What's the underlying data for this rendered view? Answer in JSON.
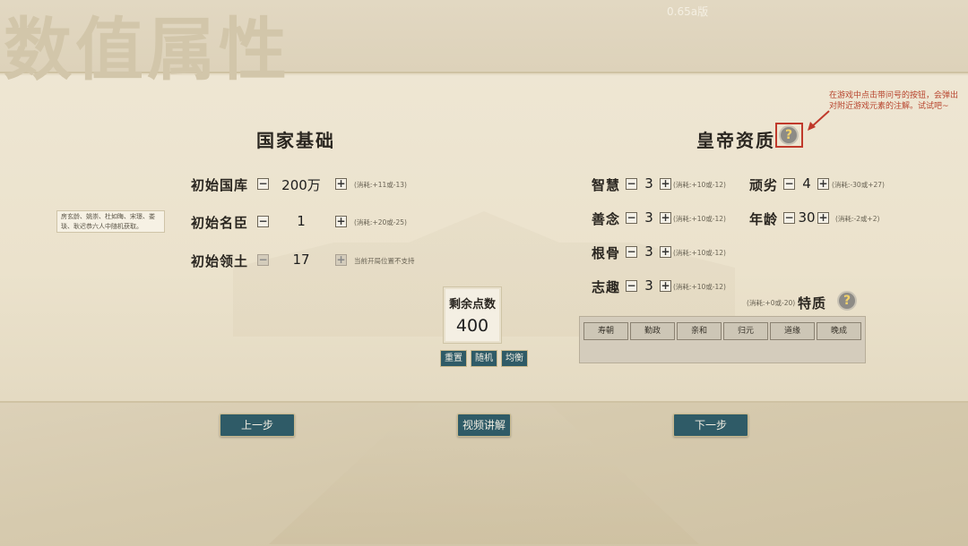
{
  "version": "0.65a版",
  "page_title": "数值属性",
  "hint": "在游戏中点击带问号的按钮，会弹出对附近游戏元素的注解。试试吧~",
  "help_symbol": "?",
  "national": {
    "heading": "国家基础",
    "treasury": {
      "label": "初始国库",
      "value": "200万",
      "cost": "(消耗:+11或-13)"
    },
    "ministers": {
      "label": "初始名臣",
      "value": "1",
      "cost": "(消耗:+20或-25)"
    },
    "territory": {
      "label": "初始领土",
      "value": "17",
      "cost": "当前开局位置不支持"
    },
    "minister_note": "房玄龄、姚崇、杜如晦、宋璟、娄琰、耿迟恭六人中随机获取。"
  },
  "points": {
    "label": "剩余点数",
    "value": "400",
    "reset": "重置",
    "random": "随机",
    "balance": "均衡"
  },
  "emperor": {
    "heading": "皇帝资质",
    "wisdom": {
      "label": "智慧",
      "value": "3",
      "cost": "(消耗:+10或-12)"
    },
    "kindness": {
      "label": "善念",
      "value": "3",
      "cost": "(消耗:+10或-12)"
    },
    "constitution": {
      "label": "根骨",
      "value": "3",
      "cost": "(消耗:+10或-12)"
    },
    "ambition": {
      "label": "志趣",
      "value": "3",
      "cost": "(消耗:+10或-12)"
    },
    "stubbornness": {
      "label": "顽劣",
      "value": "4",
      "cost": "(消耗:-30或+27)"
    },
    "age": {
      "label": "年龄",
      "value": "30",
      "cost": "(消耗:-2或+2)"
    },
    "traits": {
      "label": "特质",
      "cost": "(消耗:+0或-20)",
      "items": [
        "寿朝",
        "勤政",
        "亲和",
        "归元",
        "道缘",
        "晚成"
      ]
    }
  },
  "nav": {
    "prev": "上一步",
    "video": "视频讲解",
    "next": "下一步"
  },
  "colors": {
    "button_bg": "#2f5b67",
    "highlight": "#c0392b"
  }
}
